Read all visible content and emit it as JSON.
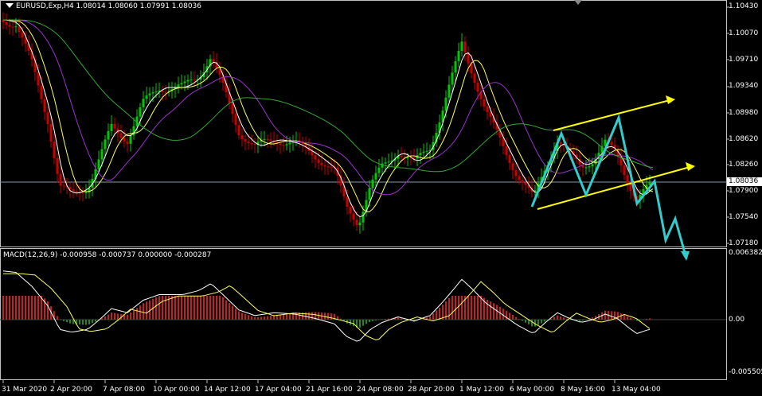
{
  "header": {
    "symbol_info": "EURUSD,Exp,H4  1.08014 1.08060 1.07991 1.08036"
  },
  "macd": {
    "info": "MACD(12,26,9) -0.000958 -0.000737 0.000000 -0.000287"
  },
  "price_scale": {
    "labels": [
      "1.10430",
      "1.10070",
      "1.09710",
      "1.09340",
      "1.08980",
      "1.08620",
      "1.08260",
      "1.07900",
      "1.07540",
      "1.07180"
    ],
    "current": "1.08036"
  },
  "macd_scale": {
    "labels": [
      "0.006382",
      "0.00",
      "-0.005505"
    ]
  },
  "time_scale": {
    "labels": [
      "31 Mar 2020",
      "2 Apr 20:00",
      "7 Apr 08:00",
      "10 Apr 00:00",
      "14 Apr 12:00",
      "17 Apr 04:00",
      "21 Apr 16:00",
      "24 Apr 08:00",
      "28 Apr 20:00",
      "1 May 12:00",
      "6 May 00:00",
      "8 May 16:00",
      "13 May 04:00"
    ]
  },
  "colors": {
    "background": "#000000",
    "bull_candle": "#00c800",
    "bear_candle": "#c80000",
    "ma_white": "#ffffff",
    "ma_yellow": "#ffff66",
    "ma_purple": "#9933cc",
    "ma_green": "#33aa33",
    "trend_arrow": "#ffff00",
    "zigzag": "#33cccc",
    "macd_hist_pos": "#c82020",
    "macd_hist_neg": "#228822",
    "grid_axis": "#c0c0c0"
  }
}
